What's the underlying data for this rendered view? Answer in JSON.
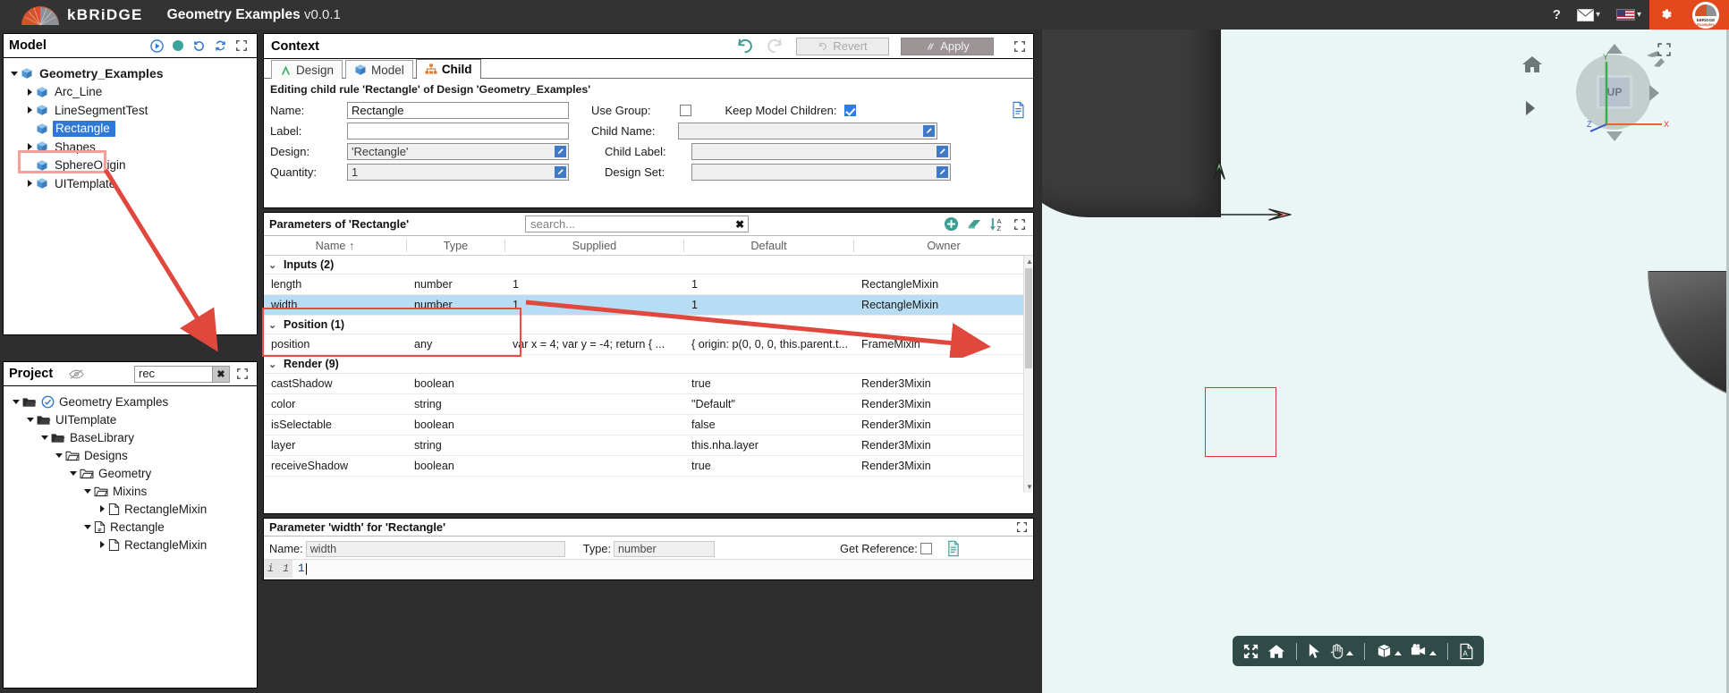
{
  "topbar": {
    "brand": "kBRiDGE",
    "app_title": "Geometry Examples",
    "version": "v0.0.1",
    "help_icon": "question-mark-icon",
    "mail_icon": "envelope-icon",
    "language_icon": "us-flag-icon",
    "settings_icon": "gear-icon",
    "account_line1": "kBRiDGE",
    "account_line2": "Examples"
  },
  "model_panel": {
    "title": "Model",
    "icons": [
      "play-icon",
      "status-dot-icon",
      "history-icon",
      "refresh-icon",
      "expand-icon"
    ],
    "tree": [
      {
        "label": "Geometry_Examples",
        "depth": 0,
        "expanded": true,
        "arrow": "down",
        "root": true,
        "selected": false
      },
      {
        "label": "Arc_Line",
        "depth": 1,
        "expanded": false,
        "arrow": "right",
        "root": false,
        "selected": false
      },
      {
        "label": "LineSegmentTest",
        "depth": 1,
        "expanded": false,
        "arrow": "right",
        "root": false,
        "selected": false
      },
      {
        "label": "Rectangle",
        "depth": 1,
        "expanded": false,
        "arrow": "none",
        "root": false,
        "selected": true
      },
      {
        "label": "Shapes",
        "depth": 1,
        "expanded": false,
        "arrow": "right",
        "root": false,
        "selected": false
      },
      {
        "label": "SphereOrigin",
        "depth": 1,
        "expanded": false,
        "arrow": "none",
        "root": false,
        "selected": false
      },
      {
        "label": "UITemplate",
        "depth": 1,
        "expanded": false,
        "arrow": "right",
        "root": false,
        "selected": false
      }
    ]
  },
  "project_panel": {
    "title": "Project",
    "eye_icon": "eye-slash-icon",
    "search_value": "rec",
    "clear_icon": "clear-x-icon",
    "expand_icon": "expand-icon",
    "tree": [
      {
        "label": "Geometry Examples",
        "depth": 0,
        "arrow": "down",
        "icon": "folder-open-icon",
        "check": true
      },
      {
        "label": "UITemplate",
        "depth": 1,
        "arrow": "down",
        "icon": "folder-open-icon",
        "check": false
      },
      {
        "label": "BaseLibrary",
        "depth": 2,
        "arrow": "down",
        "icon": "folder-open-icon",
        "check": false
      },
      {
        "label": "Designs",
        "depth": 3,
        "arrow": "down",
        "icon": "folder-outline-icon",
        "check": false
      },
      {
        "label": "Geometry",
        "depth": 4,
        "arrow": "down",
        "icon": "folder-outline-icon",
        "check": false
      },
      {
        "label": "Mixins",
        "depth": 5,
        "arrow": "down",
        "icon": "folder-outline-icon",
        "check": false
      },
      {
        "label": "RectangleMixin",
        "depth": 6,
        "arrow": "right",
        "icon": "file-icon",
        "check": false
      },
      {
        "label": "Rectangle",
        "depth": 5,
        "arrow": "down",
        "icon": "design-file-icon",
        "check": false
      },
      {
        "label": "RectangleMixin",
        "depth": 6,
        "arrow": "right",
        "icon": "file-icon",
        "check": false
      }
    ]
  },
  "context_panel": {
    "title": "Context",
    "undo_icon": "undo-icon",
    "redo_icon": "redo-icon",
    "revert_label": "Revert",
    "apply_label": "Apply",
    "expand_icon": "expand-icon",
    "tabs": [
      {
        "label": "Design",
        "icon": "design-A-icon",
        "active": false
      },
      {
        "label": "Model",
        "icon": "cube-icon",
        "active": false
      },
      {
        "label": "Child",
        "icon": "hierarchy-icon",
        "active": true
      }
    ],
    "subtitle": "Editing child rule 'Rectangle' of Design 'Geometry_Examples'",
    "fields": {
      "name_label": "Name:",
      "name_value": "Rectangle",
      "label_label": "Label:",
      "label_value": "",
      "design_label": "Design:",
      "design_value": "'Rectangle'",
      "quantity_label": "Quantity:",
      "quantity_value": "1",
      "use_group_label": "Use Group:",
      "use_group_checked": false,
      "keep_model_children_label": "Keep Model Children:",
      "keep_model_children_checked": true,
      "child_name_label": "Child Name:",
      "child_name_value": "",
      "child_label_label": "Child Label:",
      "child_label_value": "",
      "design_set_label": "Design Set:",
      "design_set_value": ""
    },
    "doc_icon": "document-icon"
  },
  "params_panel": {
    "title": "Parameters of 'Rectangle'",
    "search_placeholder": "search...",
    "search_clear_icon": "clear-x-icon",
    "tools": [
      "add-icon",
      "eraser-icon",
      "sort-az-icon",
      "expand-icon"
    ],
    "columns": [
      "Name",
      "Type",
      "Supplied",
      "Default",
      "Owner"
    ],
    "sort_column": "Name",
    "sort_arrow": "↑",
    "groups": [
      {
        "label": "Inputs (2)",
        "rows": [
          {
            "name": "length",
            "type": "number",
            "supplied": "1",
            "default": "1",
            "owner": "RectangleMixin",
            "selected": false
          },
          {
            "name": "width",
            "type": "number",
            "supplied": "1",
            "default": "1",
            "owner": "RectangleMixin",
            "selected": true
          }
        ]
      },
      {
        "label": "Position (1)",
        "rows": [
          {
            "name": "position",
            "type": "any",
            "supplied": "var x = 4; var y = -4; return { ...",
            "default": "{ origin: p(0, 0, 0, this.parent.t...",
            "owner": "FrameMixin",
            "selected": false
          }
        ]
      },
      {
        "label": "Render (9)",
        "rows": [
          {
            "name": "castShadow",
            "type": "boolean",
            "supplied": "",
            "default": "true",
            "owner": "Render3Mixin",
            "selected": false
          },
          {
            "name": "color",
            "type": "string",
            "supplied": "",
            "default": "\"Default\"",
            "owner": "Render3Mixin",
            "selected": false
          },
          {
            "name": "isSelectable",
            "type": "boolean",
            "supplied": "",
            "default": "false",
            "owner": "Render3Mixin",
            "selected": false
          },
          {
            "name": "layer",
            "type": "string",
            "supplied": "",
            "default": "this.nha.layer",
            "owner": "Render3Mixin",
            "selected": false
          },
          {
            "name": "receiveShadow",
            "type": "boolean",
            "supplied": "",
            "default": "true",
            "owner": "Render3Mixin",
            "selected": false
          }
        ]
      }
    ]
  },
  "param_editor": {
    "title": "Parameter 'width' for 'Rectangle'",
    "expand_icon": "expand-icon",
    "name_label": "Name:",
    "name_value": "width",
    "type_label": "Type:",
    "type_value": "number",
    "get_reference_label": "Get Reference:",
    "get_reference_checked": false,
    "doc_icon": "document-green-icon",
    "gutter_marker": "i",
    "line_number": "1",
    "code_value": "1"
  },
  "viewport": {
    "nav_cube_label": "UP",
    "axis_x_label": "X",
    "axis_y_label": "Y",
    "axis_z_label": "Z",
    "home_icon": "home-icon",
    "expand_icon": "expand-icon",
    "roll_icon": "roll-arrows-icon",
    "toolbar": [
      {
        "icon": "fit-screen-icon",
        "caret": false
      },
      {
        "icon": "home-icon",
        "caret": false
      },
      {
        "icon": "separator",
        "caret": false
      },
      {
        "icon": "cursor-arrow-icon",
        "caret": false
      },
      {
        "icon": "pan-hand-icon",
        "caret": true
      },
      {
        "icon": "separator",
        "caret": false
      },
      {
        "icon": "cube-view-icon",
        "caret": true
      },
      {
        "icon": "camera-icon",
        "caret": true
      },
      {
        "icon": "separator",
        "caret": false
      },
      {
        "icon": "pdf-export-icon",
        "caret": false
      }
    ]
  },
  "annotations": {
    "highlight_color": "#ef4a42",
    "arrow_color": "#e0483e"
  }
}
